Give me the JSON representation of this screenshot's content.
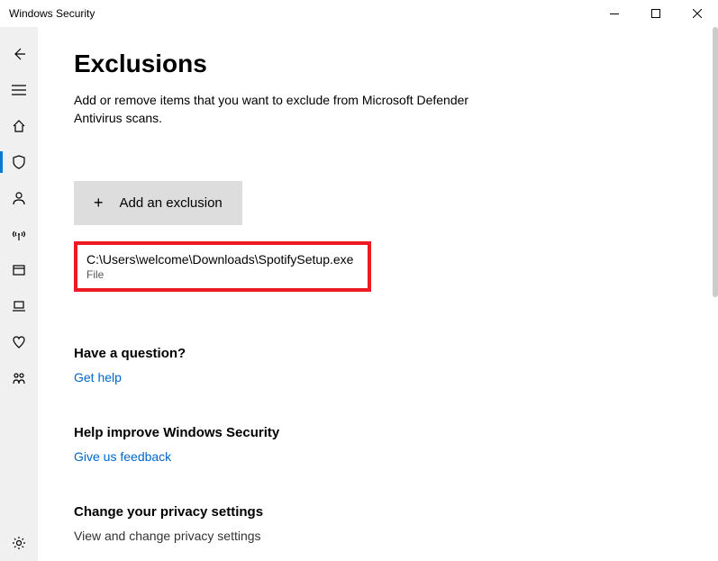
{
  "window": {
    "title": "Windows Security"
  },
  "page": {
    "title": "Exclusions",
    "subtitle": "Add or remove items that you want to exclude from Microsoft Defender Antivirus scans."
  },
  "addButton": {
    "label": "Add an exclusion"
  },
  "exclusion": {
    "path": "C:\\Users\\welcome\\Downloads\\SpotifySetup.exe",
    "type": "File"
  },
  "sections": {
    "question": {
      "heading": "Have a question?",
      "link": "Get help"
    },
    "improve": {
      "heading": "Help improve Windows Security",
      "link": "Give us feedback"
    },
    "privacy": {
      "heading": "Change your privacy settings",
      "text": "View and change privacy settings"
    }
  }
}
